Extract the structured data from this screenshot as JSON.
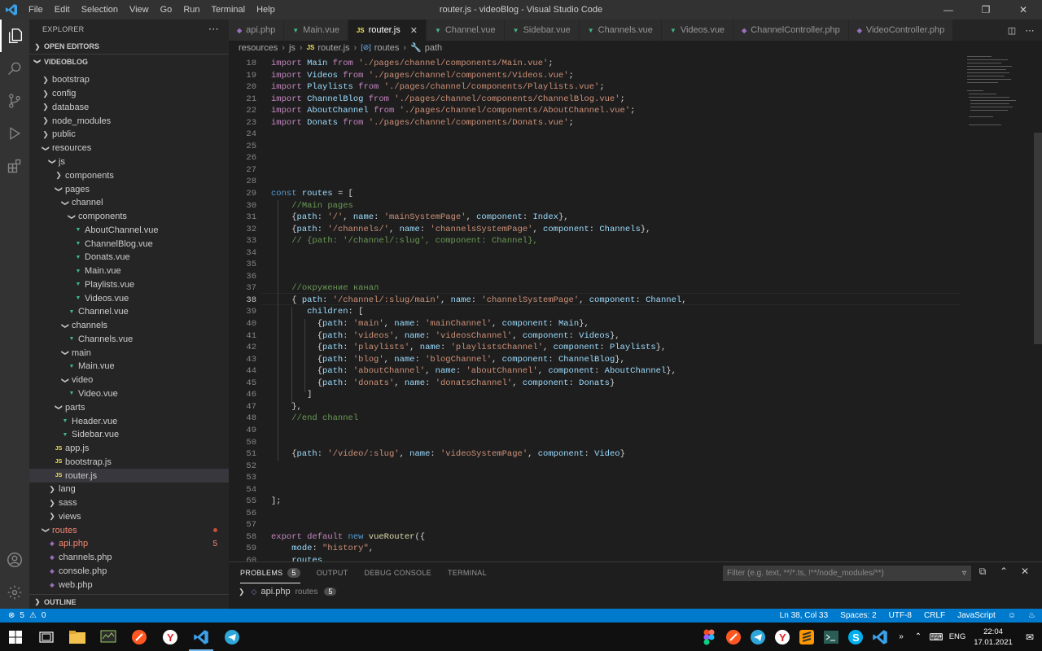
{
  "window": {
    "title": "router.js - videoBlog - Visual Studio Code",
    "menu": [
      "File",
      "Edit",
      "Selection",
      "View",
      "Go",
      "Run",
      "Terminal",
      "Help"
    ]
  },
  "sidebar": {
    "header": "EXPLORER",
    "open_editors": "OPEN EDITORS",
    "project": "VIDEOBLOG",
    "outline": "OUTLINE",
    "tree": [
      {
        "label": "bootstrap",
        "type": "folder",
        "depth": 0,
        "expanded": false
      },
      {
        "label": "config",
        "type": "folder",
        "depth": 0,
        "expanded": false
      },
      {
        "label": "database",
        "type": "folder",
        "depth": 0,
        "expanded": false
      },
      {
        "label": "node_modules",
        "type": "folder",
        "depth": 0,
        "expanded": false
      },
      {
        "label": "public",
        "type": "folder",
        "depth": 0,
        "expanded": false
      },
      {
        "label": "resources",
        "type": "folder",
        "depth": 0,
        "expanded": true
      },
      {
        "label": "js",
        "type": "folder",
        "depth": 1,
        "expanded": true
      },
      {
        "label": "components",
        "type": "folder",
        "depth": 2,
        "expanded": false
      },
      {
        "label": "pages",
        "type": "folder",
        "depth": 2,
        "expanded": true
      },
      {
        "label": "channel",
        "type": "folder",
        "depth": 3,
        "expanded": true
      },
      {
        "label": "components",
        "type": "folder",
        "depth": 4,
        "expanded": true
      },
      {
        "label": "AboutChannel.vue",
        "type": "vue",
        "depth": 5
      },
      {
        "label": "ChannelBlog.vue",
        "type": "vue",
        "depth": 5
      },
      {
        "label": "Donats.vue",
        "type": "vue",
        "depth": 5
      },
      {
        "label": "Main.vue",
        "type": "vue",
        "depth": 5
      },
      {
        "label": "Playlists.vue",
        "type": "vue",
        "depth": 5
      },
      {
        "label": "Videos.vue",
        "type": "vue",
        "depth": 5
      },
      {
        "label": "Channel.vue",
        "type": "vue",
        "depth": 4
      },
      {
        "label": "channels",
        "type": "folder",
        "depth": 3,
        "expanded": true
      },
      {
        "label": "Channels.vue",
        "type": "vue",
        "depth": 4
      },
      {
        "label": "main",
        "type": "folder",
        "depth": 3,
        "expanded": true
      },
      {
        "label": "Main.vue",
        "type": "vue",
        "depth": 4
      },
      {
        "label": "video",
        "type": "folder",
        "depth": 3,
        "expanded": true
      },
      {
        "label": "Video.vue",
        "type": "vue",
        "depth": 4
      },
      {
        "label": "parts",
        "type": "folder",
        "depth": 2,
        "expanded": true
      },
      {
        "label": "Header.vue",
        "type": "vue",
        "depth": 3
      },
      {
        "label": "Sidebar.vue",
        "type": "vue",
        "depth": 3
      },
      {
        "label": "app.js",
        "type": "js",
        "depth": 2
      },
      {
        "label": "bootstrap.js",
        "type": "js",
        "depth": 2
      },
      {
        "label": "router.js",
        "type": "js",
        "depth": 2,
        "selected": true
      },
      {
        "label": "lang",
        "type": "folder",
        "depth": 1,
        "expanded": false
      },
      {
        "label": "sass",
        "type": "folder",
        "depth": 1,
        "expanded": false
      },
      {
        "label": "views",
        "type": "folder",
        "depth": 1,
        "expanded": false
      },
      {
        "label": "routes",
        "type": "folder",
        "depth": 0,
        "expanded": true,
        "error": true,
        "dot": true
      },
      {
        "label": "api.php",
        "type": "php",
        "depth": 1,
        "error": true,
        "badge": "5"
      },
      {
        "label": "channels.php",
        "type": "php",
        "depth": 1
      },
      {
        "label": "console.php",
        "type": "php",
        "depth": 1
      },
      {
        "label": "web.php",
        "type": "php",
        "depth": 1
      }
    ]
  },
  "tabs": [
    {
      "label": "api.php",
      "type": "php"
    },
    {
      "label": "Main.vue",
      "type": "vue"
    },
    {
      "label": "router.js",
      "type": "js",
      "active": true
    },
    {
      "label": "Channel.vue",
      "type": "vue"
    },
    {
      "label": "Sidebar.vue",
      "type": "vue"
    },
    {
      "label": "Channels.vue",
      "type": "vue"
    },
    {
      "label": "Videos.vue",
      "type": "vue"
    },
    {
      "label": "ChannelController.php",
      "type": "php"
    },
    {
      "label": "VideoController.php",
      "type": "php"
    }
  ],
  "breadcrumb": [
    "resources",
    "js",
    "router.js",
    "routes",
    "path"
  ],
  "editor": {
    "line_numbers": [
      "18",
      "19",
      "20",
      "21",
      "22",
      "23",
      "24",
      "25",
      "26",
      "27",
      "28",
      "29",
      "30",
      "31",
      "32",
      "33",
      "34",
      "35",
      "36",
      "37",
      "38",
      "39",
      "40",
      "41",
      "42",
      "43",
      "44",
      "45",
      "46",
      "47",
      "48",
      "49",
      "50",
      "51",
      "52",
      "53",
      "54",
      "55",
      "56",
      "57",
      "58",
      "59",
      "60"
    ],
    "current_line": "38",
    "lines": [
      [
        [
          "k",
          "import"
        ],
        [
          "p",
          " "
        ],
        [
          "v",
          "Main"
        ],
        [
          "p",
          " "
        ],
        [
          "k",
          "from"
        ],
        [
          "p",
          " "
        ],
        [
          "s",
          "'./pages/channel/components/Main.vue'"
        ],
        [
          "p",
          ";"
        ]
      ],
      [
        [
          "k",
          "import"
        ],
        [
          "p",
          " "
        ],
        [
          "v",
          "Videos"
        ],
        [
          "p",
          " "
        ],
        [
          "k",
          "from"
        ],
        [
          "p",
          " "
        ],
        [
          "s",
          "'./pages/channel/components/Videos.vue'"
        ],
        [
          "p",
          ";"
        ]
      ],
      [
        [
          "k",
          "import"
        ],
        [
          "p",
          " "
        ],
        [
          "v",
          "Playlists"
        ],
        [
          "p",
          " "
        ],
        [
          "k",
          "from"
        ],
        [
          "p",
          " "
        ],
        [
          "s",
          "'./pages/channel/components/Playlists.vue'"
        ],
        [
          "p",
          ";"
        ]
      ],
      [
        [
          "k",
          "import"
        ],
        [
          "p",
          " "
        ],
        [
          "v",
          "ChannelBlog"
        ],
        [
          "p",
          " "
        ],
        [
          "k",
          "from"
        ],
        [
          "p",
          " "
        ],
        [
          "s",
          "'./pages/channel/components/ChannelBlog.vue'"
        ],
        [
          "p",
          ";"
        ]
      ],
      [
        [
          "k",
          "import"
        ],
        [
          "p",
          " "
        ],
        [
          "v",
          "AboutChannel"
        ],
        [
          "p",
          " "
        ],
        [
          "k",
          "from"
        ],
        [
          "p",
          " "
        ],
        [
          "s",
          "'./pages/channel/components/AboutChannel.vue'"
        ],
        [
          "p",
          ";"
        ]
      ],
      [
        [
          "k",
          "import"
        ],
        [
          "p",
          " "
        ],
        [
          "v",
          "Donats"
        ],
        [
          "p",
          " "
        ],
        [
          "k",
          "from"
        ],
        [
          "p",
          " "
        ],
        [
          "s",
          "'./pages/channel/components/Donats.vue'"
        ],
        [
          "p",
          ";"
        ]
      ],
      [],
      [],
      [],
      [],
      [],
      [
        [
          "kw",
          "const"
        ],
        [
          "p",
          " "
        ],
        [
          "v",
          "routes"
        ],
        [
          "p",
          " = ["
        ]
      ],
      [
        [
          "p",
          "    "
        ],
        [
          "c",
          "//Main pages"
        ]
      ],
      [
        [
          "p",
          "    {"
        ],
        [
          "v",
          "path"
        ],
        [
          "p",
          ": "
        ],
        [
          "s",
          "'/'"
        ],
        [
          "p",
          ", "
        ],
        [
          "v",
          "name"
        ],
        [
          "p",
          ": "
        ],
        [
          "s",
          "'mainSystemPage'"
        ],
        [
          "p",
          ", "
        ],
        [
          "v",
          "component"
        ],
        [
          "p",
          ": "
        ],
        [
          "v",
          "Index"
        ],
        [
          "p",
          "},"
        ]
      ],
      [
        [
          "p",
          "    {"
        ],
        [
          "v",
          "path"
        ],
        [
          "p",
          ": "
        ],
        [
          "s",
          "'/channels/'"
        ],
        [
          "p",
          ", "
        ],
        [
          "v",
          "name"
        ],
        [
          "p",
          ": "
        ],
        [
          "s",
          "'channelsSystemPage'"
        ],
        [
          "p",
          ", "
        ],
        [
          "v",
          "component"
        ],
        [
          "p",
          ": "
        ],
        [
          "v",
          "Channels"
        ],
        [
          "p",
          "},"
        ]
      ],
      [
        [
          "p",
          "    "
        ],
        [
          "c",
          "// {path: '/channel/:slug', component: Channel},"
        ]
      ],
      [],
      [],
      [],
      [
        [
          "p",
          "    "
        ],
        [
          "c",
          "//окружение канал"
        ]
      ],
      [
        [
          "p",
          "    { "
        ],
        [
          "v",
          "path"
        ],
        [
          "p",
          ": "
        ],
        [
          "s",
          "'/channel/:slug/main'"
        ],
        [
          "p",
          ", "
        ],
        [
          "v",
          "name"
        ],
        [
          "p",
          ": "
        ],
        [
          "s",
          "'channelSystemPage'"
        ],
        [
          "p",
          ", "
        ],
        [
          "v",
          "component"
        ],
        [
          "p",
          ": "
        ],
        [
          "v",
          "Channel"
        ],
        [
          "p",
          ","
        ]
      ],
      [
        [
          "p",
          "       "
        ],
        [
          "v",
          "children"
        ],
        [
          "p",
          ": ["
        ]
      ],
      [
        [
          "p",
          "         {"
        ],
        [
          "v",
          "path"
        ],
        [
          "p",
          ": "
        ],
        [
          "s",
          "'main'"
        ],
        [
          "p",
          ", "
        ],
        [
          "v",
          "name"
        ],
        [
          "p",
          ": "
        ],
        [
          "s",
          "'mainChannel'"
        ],
        [
          "p",
          ", "
        ],
        [
          "v",
          "component"
        ],
        [
          "p",
          ": "
        ],
        [
          "v",
          "Main"
        ],
        [
          "p",
          "},"
        ]
      ],
      [
        [
          "p",
          "         {"
        ],
        [
          "v",
          "path"
        ],
        [
          "p",
          ": "
        ],
        [
          "s",
          "'videos'"
        ],
        [
          "p",
          ", "
        ],
        [
          "v",
          "name"
        ],
        [
          "p",
          ": "
        ],
        [
          "s",
          "'videosChannel'"
        ],
        [
          "p",
          ", "
        ],
        [
          "v",
          "component"
        ],
        [
          "p",
          ": "
        ],
        [
          "v",
          "Videos"
        ],
        [
          "p",
          "},"
        ]
      ],
      [
        [
          "p",
          "         {"
        ],
        [
          "v",
          "path"
        ],
        [
          "p",
          ": "
        ],
        [
          "s",
          "'playlists'"
        ],
        [
          "p",
          ", "
        ],
        [
          "v",
          "name"
        ],
        [
          "p",
          ": "
        ],
        [
          "s",
          "'playlistsChannel'"
        ],
        [
          "p",
          ", "
        ],
        [
          "v",
          "component"
        ],
        [
          "p",
          ": "
        ],
        [
          "v",
          "Playlists"
        ],
        [
          "p",
          "},"
        ]
      ],
      [
        [
          "p",
          "         {"
        ],
        [
          "v",
          "path"
        ],
        [
          "p",
          ": "
        ],
        [
          "s",
          "'blog'"
        ],
        [
          "p",
          ", "
        ],
        [
          "v",
          "name"
        ],
        [
          "p",
          ": "
        ],
        [
          "s",
          "'blogChannel'"
        ],
        [
          "p",
          ", "
        ],
        [
          "v",
          "component"
        ],
        [
          "p",
          ": "
        ],
        [
          "v",
          "ChannelBlog"
        ],
        [
          "p",
          "},"
        ]
      ],
      [
        [
          "p",
          "         {"
        ],
        [
          "v",
          "path"
        ],
        [
          "p",
          ": "
        ],
        [
          "s",
          "'aboutChannel'"
        ],
        [
          "p",
          ", "
        ],
        [
          "v",
          "name"
        ],
        [
          "p",
          ": "
        ],
        [
          "s",
          "'aboutChannel'"
        ],
        [
          "p",
          ", "
        ],
        [
          "v",
          "component"
        ],
        [
          "p",
          ": "
        ],
        [
          "v",
          "AboutChannel"
        ],
        [
          "p",
          "},"
        ]
      ],
      [
        [
          "p",
          "         {"
        ],
        [
          "v",
          "path"
        ],
        [
          "p",
          ": "
        ],
        [
          "s",
          "'donats'"
        ],
        [
          "p",
          ", "
        ],
        [
          "v",
          "name"
        ],
        [
          "p",
          ": "
        ],
        [
          "s",
          "'donatsChannel'"
        ],
        [
          "p",
          ", "
        ],
        [
          "v",
          "component"
        ],
        [
          "p",
          ": "
        ],
        [
          "v",
          "Donats"
        ],
        [
          "p",
          "}"
        ]
      ],
      [
        [
          "p",
          "       ]"
        ]
      ],
      [
        [
          "p",
          "    },"
        ]
      ],
      [
        [
          "p",
          "    "
        ],
        [
          "c",
          "//end channel"
        ]
      ],
      [],
      [],
      [
        [
          "p",
          "    {"
        ],
        [
          "v",
          "path"
        ],
        [
          "p",
          ": "
        ],
        [
          "s",
          "'/video/:slug'"
        ],
        [
          "p",
          ", "
        ],
        [
          "v",
          "name"
        ],
        [
          "p",
          ": "
        ],
        [
          "s",
          "'videoSystemPage'"
        ],
        [
          "p",
          ", "
        ],
        [
          "v",
          "component"
        ],
        [
          "p",
          ": "
        ],
        [
          "v",
          "Video"
        ],
        [
          "p",
          "}"
        ]
      ],
      [],
      [],
      [],
      [
        [
          "p",
          "];"
        ]
      ],
      [],
      [],
      [
        [
          "k",
          "export"
        ],
        [
          "p",
          " "
        ],
        [
          "k",
          "default"
        ],
        [
          "p",
          " "
        ],
        [
          "kw",
          "new"
        ],
        [
          "p",
          " "
        ],
        [
          "f",
          "vueRouter"
        ],
        [
          "p",
          "({"
        ]
      ],
      [
        [
          "p",
          "    "
        ],
        [
          "v",
          "mode"
        ],
        [
          "p",
          ": "
        ],
        [
          "s",
          "\"history\""
        ],
        [
          "p",
          ","
        ]
      ],
      [
        [
          "p",
          "    "
        ],
        [
          "v",
          "routes"
        ]
      ]
    ]
  },
  "panel": {
    "tabs": [
      {
        "label": "PROBLEMS",
        "count": "5",
        "active": true
      },
      {
        "label": "OUTPUT"
      },
      {
        "label": "DEBUG CONSOLE"
      },
      {
        "label": "TERMINAL"
      }
    ],
    "filter_placeholder": "Filter (e.g. text, **/*.ts, !**/node_modules/**)",
    "problem_file": "api.php",
    "problem_path": "routes",
    "problem_count": "5"
  },
  "statusbar": {
    "errors": "5",
    "warnings": "0",
    "position": "Ln 38, Col 33",
    "spaces": "Spaces: 2",
    "encoding": "UTF-8",
    "eol": "CRLF",
    "language": "JavaScript"
  },
  "taskbar": {
    "lang": "ENG",
    "time": "22:04",
    "date": "17.01.2021"
  },
  "colors": {
    "accent": "#007acc",
    "vue": "#41b883",
    "js": "#f1e05a",
    "php": "#a074c4",
    "error": "#f48771",
    "modified": "#e2c08d"
  }
}
